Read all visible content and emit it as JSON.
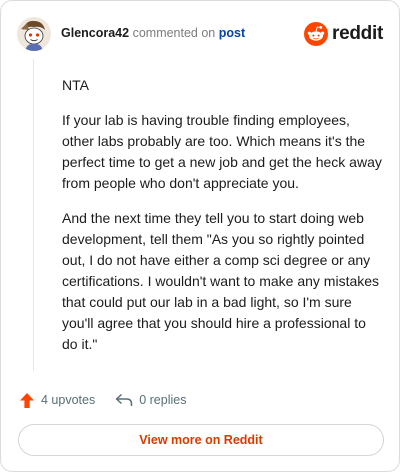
{
  "header": {
    "username": "Glencora42",
    "commented_text": "commented on",
    "post_link": "post",
    "brand": "reddit"
  },
  "comment": {
    "paragraphs": [
      "NTA",
      "If your lab is having trouble finding employees, other labs probably are too. Which means it's the perfect time to get a new job and get the heck away from people who don't appreciate you.",
      "And the next time they tell you to start doing web development, tell them \"As you so rightly pointed out, I do not have either a comp sci degree or any certifications. I wouldn't want to make any mistakes that could put our lab in a bad light, so I'm sure you'll agree that you should hire a professional to do it.\""
    ]
  },
  "actions": {
    "upvotes": "4 upvotes",
    "replies": "0 replies"
  },
  "footer": {
    "view_more": "View more on Reddit"
  },
  "colors": {
    "accent": "#ff4500",
    "link": "#0045ac",
    "view_more": "#d93a00"
  },
  "icons": {
    "avatar": "snoo-avatar",
    "brand": "reddit-logo-icon",
    "upvote": "upvote-arrow-icon",
    "reply": "reply-arrow-icon"
  }
}
